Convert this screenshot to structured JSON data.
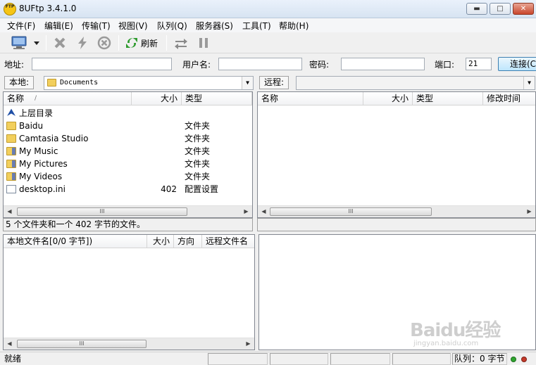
{
  "window": {
    "title": "8UFtp 3.4.1.0",
    "app_icon_text": "FTP"
  },
  "menu": [
    "文件(F)",
    "编辑(E)",
    "传输(T)",
    "视图(V)",
    "队列(Q)",
    "服务器(S)",
    "工具(T)",
    "帮助(H)"
  ],
  "toolbar": {
    "refresh_label": "刷新"
  },
  "address": {
    "address_label": "地址:",
    "address_value": "",
    "user_label": "用户名:",
    "user_value": "",
    "password_label": "密码:",
    "password_value": "",
    "port_label": "端口:",
    "port_value": "21",
    "connect_label": "连接(C)"
  },
  "local": {
    "label": "本地:",
    "path": "Documents",
    "columns": {
      "name": "名称",
      "sort_mark": "/",
      "size": "大小",
      "type": "类型"
    },
    "files": [
      {
        "name": "上层目录",
        "size": "",
        "type": "",
        "icon": "up-folder-icon"
      },
      {
        "name": "Baidu",
        "size": "",
        "type": "文件夹",
        "icon": "folder-icon"
      },
      {
        "name": "Camtasia Studio",
        "size": "",
        "type": "文件夹",
        "icon": "folder-icon"
      },
      {
        "name": "My Music",
        "size": "",
        "type": "文件夹",
        "icon": "music-folder-icon"
      },
      {
        "name": "My Pictures",
        "size": "",
        "type": "文件夹",
        "icon": "pictures-folder-icon"
      },
      {
        "name": "My Videos",
        "size": "",
        "type": "文件夹",
        "icon": "videos-folder-icon"
      },
      {
        "name": "desktop.ini",
        "size": "402",
        "type": "配置设置",
        "icon": "settings-file-icon"
      }
    ],
    "status": "5 个文件夹和一个 402 字节的文件。"
  },
  "remote": {
    "label": "远程:",
    "path": "",
    "columns": {
      "name": "名称",
      "size": "大小",
      "type": "类型",
      "modified": "修改时间"
    }
  },
  "queue": {
    "columns": {
      "local_name": "本地文件名[0/0 字节])",
      "size": "大小",
      "direction": "方向",
      "remote_name": "远程文件名"
    }
  },
  "statusbar": {
    "ready": "就绪",
    "queue": "队列：0 字节"
  },
  "scroll_grip": "III",
  "watermark": {
    "logo": "Baidu经验",
    "url": "jingyan.baidu.com"
  },
  "colors": {
    "selection_blue": "#3c7fb1",
    "folder_yellow": "#f2cf5c",
    "led_green": "#2fa52f",
    "led_red": "#c43a2a"
  }
}
